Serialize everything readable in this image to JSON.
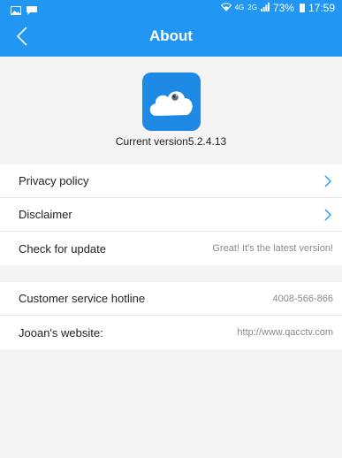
{
  "status_bar": {
    "network": "4G",
    "network_secondary": "2G",
    "battery": "73%",
    "time": "17:59",
    "icons": [
      "image-icon",
      "message-icon",
      "wifi-icon",
      "signal-icon",
      "battery-icon"
    ]
  },
  "header": {
    "title": "About",
    "back_icon": "chevron-left-icon"
  },
  "app": {
    "logo_icon": "cloud-camera-logo",
    "version_label": "Current version5.2.4.13"
  },
  "items": [
    {
      "label": "Privacy policy",
      "value": "",
      "arrow": true
    },
    {
      "label": "Disclaimer",
      "value": "",
      "arrow": true
    },
    {
      "label": "Check for update",
      "value": "Great! It's the latest version!",
      "arrow": false
    }
  ],
  "contact": [
    {
      "label": "Customer service hotline",
      "value": "4008-566-866"
    },
    {
      "label": "Jooan's website:",
      "value": "http://www.qacctv.com"
    }
  ],
  "colors": {
    "accent": "#2196f3",
    "background": "#f4f4f4",
    "arrow": "#2196f3",
    "logo_bg": "#1e88e5"
  }
}
